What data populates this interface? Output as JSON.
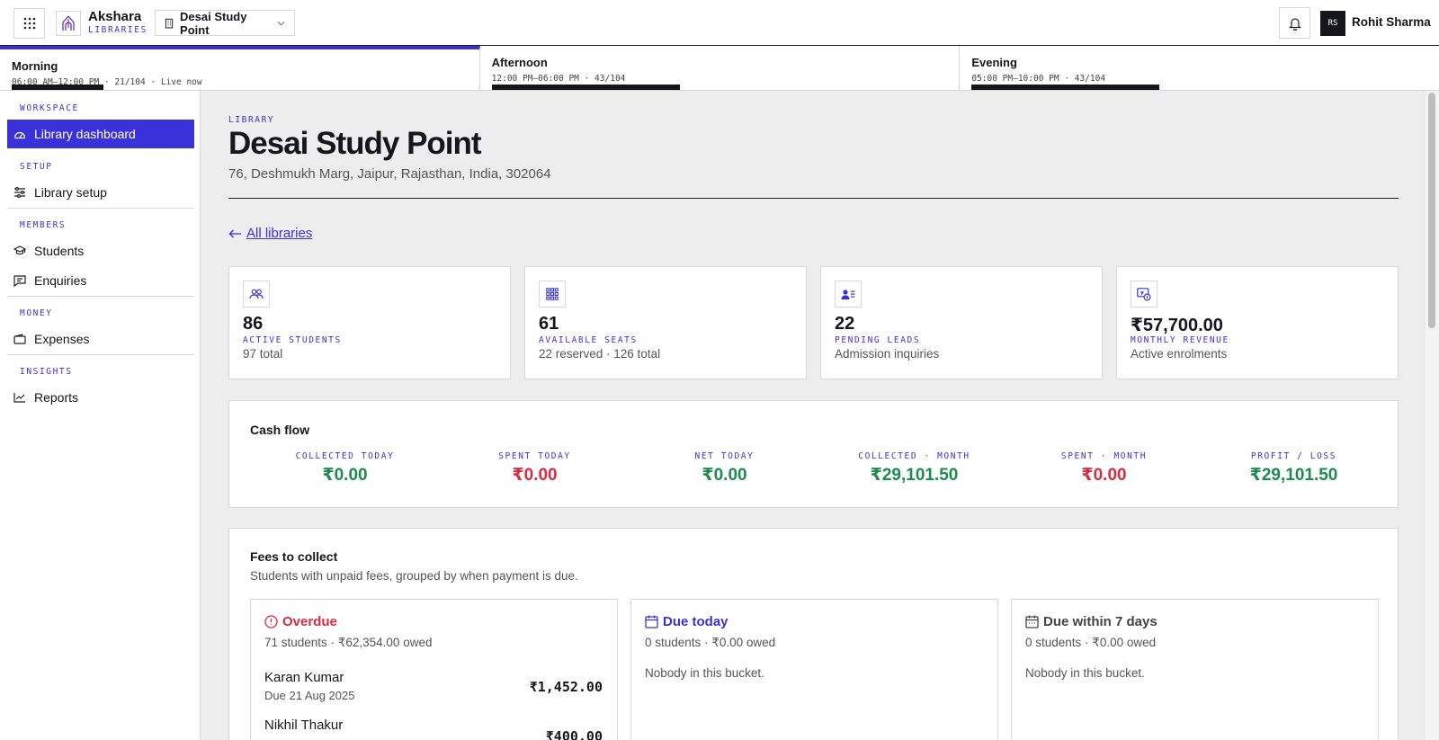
{
  "header": {
    "brand_name": "Akshara",
    "brand_sub": "LIBRARIES",
    "library_selected": "Desai Study Point",
    "user_initials": "RS",
    "user_name": "Rohit Sharma"
  },
  "shifts": [
    {
      "label": "Morning",
      "meta": "06:00 AM–12:00 PM · 21/104 · Live now",
      "occupancy": 0.2,
      "active": true
    },
    {
      "label": "Afternoon",
      "meta": "12:00 PM–06:00 PM · 43/104",
      "occupancy": 0.41,
      "active": false
    },
    {
      "label": "Evening",
      "meta": "05:00 PM–10:00 PM · 43/104",
      "occupancy": 0.41,
      "active": false
    }
  ],
  "sidebar": {
    "sections": [
      "WORKSPACE",
      "SETUP",
      "MEMBERS",
      "MONEY",
      "INSIGHTS"
    ],
    "items": [
      {
        "label": "Library dashboard",
        "icon": "dashboard-icon",
        "active": true
      },
      {
        "label": "Library setup",
        "icon": "sliders-icon"
      },
      {
        "label": "Students",
        "icon": "graduation-cap-icon"
      },
      {
        "label": "Enquiries",
        "icon": "message-icon"
      },
      {
        "label": "Expenses",
        "icon": "wallet-icon"
      },
      {
        "label": "Reports",
        "icon": "line-chart-icon"
      }
    ]
  },
  "page": {
    "eyebrow": "LIBRARY",
    "title": "Desai Study Point",
    "address": "76, Deshmukh Marg, Jaipur, Rajasthan, India, 302064",
    "back_link": "All libraries"
  },
  "stats": [
    {
      "value": "86",
      "label": "ACTIVE STUDENTS",
      "sub": "97 total",
      "icon": "users-icon"
    },
    {
      "value": "61",
      "label": "AVAILABLE SEATS",
      "sub": "22 reserved · 126 total",
      "icon": "grid-icon"
    },
    {
      "value": "22",
      "label": "PENDING LEADS",
      "sub": "Admission inquiries",
      "icon": "contact-list-icon"
    },
    {
      "value": "₹57,700.00",
      "label": "MONTHLY REVENUE",
      "sub": "Active enrolments",
      "icon": "revenue-icon"
    }
  ],
  "cashflow": {
    "title": "Cash flow",
    "items": [
      {
        "label": "COLLECTED TODAY",
        "value": "₹0.00",
        "tone": "green"
      },
      {
        "label": "SPENT TODAY",
        "value": "₹0.00",
        "tone": "red"
      },
      {
        "label": "NET TODAY",
        "value": "₹0.00",
        "tone": "green"
      },
      {
        "label": "COLLECTED · MONTH",
        "value": "₹29,101.50",
        "tone": "green"
      },
      {
        "label": "SPENT · MONTH",
        "value": "₹0.00",
        "tone": "red"
      },
      {
        "label": "PROFIT / LOSS",
        "value": "₹29,101.50",
        "tone": "green"
      }
    ]
  },
  "fees": {
    "title": "Fees to collect",
    "subtitle": "Students with unpaid fees, grouped by when payment is due.",
    "buckets": [
      {
        "title": "Overdue",
        "meta": "71 students · ₹62,354.00 owed",
        "color": "#d92c3f",
        "icon": "alert-circle-icon",
        "rows": [
          {
            "name": "Karan Kumar",
            "due": "Due 21 Aug 2025",
            "amount": "₹1,452.00"
          },
          {
            "name": "Nikhil Thakur",
            "due": "",
            "amount": "₹400.00"
          }
        ]
      },
      {
        "title": "Due today",
        "meta": "0 students · ₹0.00 owed",
        "color": "#3b31d8",
        "icon": "calendar-icon",
        "empty": "Nobody in this bucket."
      },
      {
        "title": "Due within 7 days",
        "meta": "0 students · ₹0.00 owed",
        "color": "#444444",
        "icon": "calendar-week-icon",
        "empty": "Nobody in this bucket."
      }
    ]
  },
  "colors": {
    "accent": "#3b31d8",
    "positive": "#1d8a4e",
    "negative": "#d92c3f",
    "dark": "#15151c"
  }
}
